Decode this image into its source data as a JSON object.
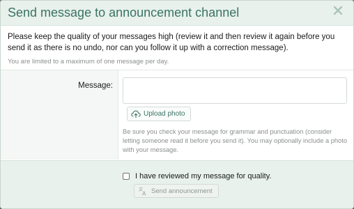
{
  "dialog": {
    "title": "Send message to announcement channel",
    "close_icon": "close-icon"
  },
  "intro": {
    "text": "Please keep the quality of your messages high (review it and then review it again before you send it as there is no undo, nor can you follow it up with a correction message).",
    "note": "You are limited to a maximum of one message per day."
  },
  "form": {
    "message_label": "Message:",
    "message_value": "",
    "upload_label": "Upload photo",
    "upload_icon": "upload-icon",
    "help_text": "Be sure you check your message for grammar and punctuation (consider letting someone read it before you send it). You may optionally include a photo with your message."
  },
  "footer": {
    "checkbox_label": "I have reviewed my message for quality.",
    "checkbox_checked": false,
    "send_label": "Send announcement",
    "send_icon": "translate-icon",
    "send_disabled": true
  },
  "colors": {
    "accent": "#3a7364",
    "header_bg": "#e8f1ec",
    "muted_text": "#8a8f8c"
  }
}
